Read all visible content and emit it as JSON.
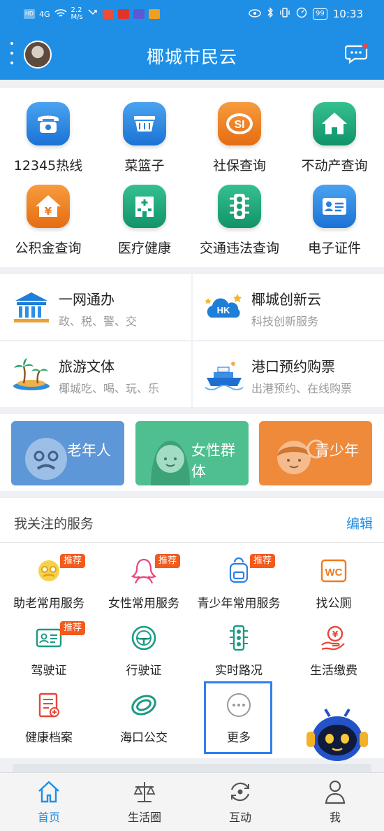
{
  "status_bar": {
    "network_label": "HD",
    "signal_label": "4G",
    "speed_value": "2.2",
    "speed_unit": "M/s",
    "battery": "99",
    "time": "10:33"
  },
  "app_bar": {
    "title": "椰城市民云"
  },
  "quick_grid": [
    {
      "label": "12345热线",
      "icon": "phone-icon",
      "color": "blue"
    },
    {
      "label": "菜篮子",
      "icon": "basket-icon",
      "color": "blue"
    },
    {
      "label": "社保查询",
      "icon": "social-security-icon",
      "color": "orange"
    },
    {
      "label": "不动产查询",
      "icon": "house-icon",
      "color": "green"
    },
    {
      "label": "公积金查询",
      "icon": "housing-fund-icon",
      "color": "orange"
    },
    {
      "label": "医疗健康",
      "icon": "hospital-icon",
      "color": "green"
    },
    {
      "label": "交通违法查询",
      "icon": "traffic-light-icon",
      "color": "green"
    },
    {
      "label": "电子证件",
      "icon": "id-card-icon",
      "color": "blue"
    }
  ],
  "service_blocks": [
    {
      "title": "一网通办",
      "subtitle": "政、税、警、交",
      "icon": "government-building-icon"
    },
    {
      "title": "椰城创新云",
      "subtitle": "科技创新服务",
      "icon": "hk-cloud-icon"
    },
    {
      "title": "旅游文体",
      "subtitle": "椰城吃、喝、玩、乐",
      "icon": "palm-island-icon"
    },
    {
      "title": "港口预约购票",
      "subtitle": "出港预约、在线购票",
      "icon": "ship-icon"
    }
  ],
  "banners": [
    {
      "label": "老年人",
      "color": "#5d97d8"
    },
    {
      "label": "女性群体",
      "color": "#4fbf8f"
    },
    {
      "label": "青少年",
      "color": "#ef8a3b"
    }
  ],
  "my_services": {
    "title": "我关注的服务",
    "edit_label": "编辑",
    "items": [
      {
        "label": "助老常用服务",
        "badge": "推荐",
        "icon": "elderly-face-icon"
      },
      {
        "label": "女性常用服务",
        "badge": "推荐",
        "icon": "woman-icon"
      },
      {
        "label": "青少年常用服务",
        "badge": "推荐",
        "icon": "backpack-icon"
      },
      {
        "label": "找公厕",
        "badge": "",
        "icon": "wc-icon"
      },
      {
        "label": "驾驶证",
        "badge": "推荐",
        "icon": "driver-license-icon"
      },
      {
        "label": "行驶证",
        "badge": "",
        "icon": "steering-wheel-icon"
      },
      {
        "label": "实时路况",
        "badge": "",
        "icon": "traffic-light-icon"
      },
      {
        "label": "生活缴费",
        "badge": "",
        "icon": "payment-icon"
      },
      {
        "label": "健康档案",
        "badge": "",
        "icon": "health-record-icon"
      },
      {
        "label": "海口公交",
        "badge": "",
        "icon": "bus-logo-icon"
      },
      {
        "label": "更多",
        "badge": "",
        "icon": "more-icon"
      }
    ]
  },
  "bottom_nav": [
    {
      "label": "首页",
      "icon": "home-icon",
      "active": true
    },
    {
      "label": "生活圈",
      "icon": "scale-icon",
      "active": false
    },
    {
      "label": "互动",
      "icon": "interaction-icon",
      "active": false
    },
    {
      "label": "我",
      "icon": "person-icon",
      "active": false
    }
  ],
  "colors": {
    "primary": "#1f8fe6",
    "badge": "#f25a1e",
    "highlight_border": "#2f7ff0"
  }
}
